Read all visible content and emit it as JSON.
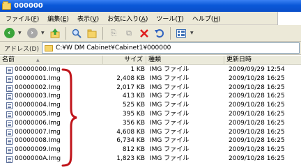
{
  "window": {
    "title": "000000"
  },
  "menu": [
    {
      "text": "ファイル(",
      "key": "F",
      "close": ")"
    },
    {
      "text": "編集(",
      "key": "E",
      "close": ")"
    },
    {
      "text": "表示(",
      "key": "V",
      "close": ")"
    },
    {
      "text": "お気に入り(",
      "key": "A",
      "close": ")"
    },
    {
      "text": "ツール(",
      "key": "T",
      "close": ")"
    },
    {
      "text": "ヘルプ(",
      "key": "H",
      "close": ")"
    }
  ],
  "address": {
    "label": "アドレス(D)",
    "path": "C:¥W DM Cabinet¥Cabinet1¥000000"
  },
  "columns": {
    "name": "名前",
    "size": "サイズ",
    "type": "種類",
    "date": "更新日時"
  },
  "files": [
    {
      "name": "00000000.Img",
      "size": "1 KB",
      "type": "IMG ファイル",
      "date": "2009/09/29 12:54"
    },
    {
      "name": "00000001.Img",
      "size": "2,408 KB",
      "type": "IMG ファイル",
      "date": "2009/10/28 16:25"
    },
    {
      "name": "00000002.Img",
      "size": "2,017 KB",
      "type": "IMG ファイル",
      "date": "2009/10/28 16:25"
    },
    {
      "name": "00000003.Img",
      "size": "413 KB",
      "type": "IMG ファイル",
      "date": "2009/10/28 16:25"
    },
    {
      "name": "00000004.Img",
      "size": "525 KB",
      "type": "IMG ファイル",
      "date": "2009/10/28 16:25"
    },
    {
      "name": "00000005.Img",
      "size": "395 KB",
      "type": "IMG ファイル",
      "date": "2009/10/28 16:25"
    },
    {
      "name": "00000006.Img",
      "size": "356 KB",
      "type": "IMG ファイル",
      "date": "2009/10/28 16:25"
    },
    {
      "name": "00000007.Img",
      "size": "4,608 KB",
      "type": "IMG ファイル",
      "date": "2009/10/28 16:25"
    },
    {
      "name": "00000008.Img",
      "size": "6,734 KB",
      "type": "IMG ファイル",
      "date": "2009/10/28 16:25"
    },
    {
      "name": "00000009.Img",
      "size": "812 KB",
      "type": "IMG ファイル",
      "date": "2009/10/28 16:25"
    },
    {
      "name": "0000000A.Img",
      "size": "1,823 KB",
      "type": "IMG ファイル",
      "date": "2009/10/28 16:25"
    }
  ],
  "icons": {
    "title": "folder-icon",
    "back": "back-icon",
    "forward": "forward-icon",
    "up": "up-folder-icon",
    "search": "search-icon",
    "folders": "folders-icon",
    "move": "move-to-icon",
    "copy": "copy-to-icon",
    "delete": "delete-icon",
    "undo": "undo-icon",
    "views": "views-icon",
    "file": "img-file-icon"
  },
  "colors": {
    "titlebar": "#0a58d8",
    "brace": "#c0151b",
    "back": "#3aa43a",
    "delete": "#e02020"
  }
}
